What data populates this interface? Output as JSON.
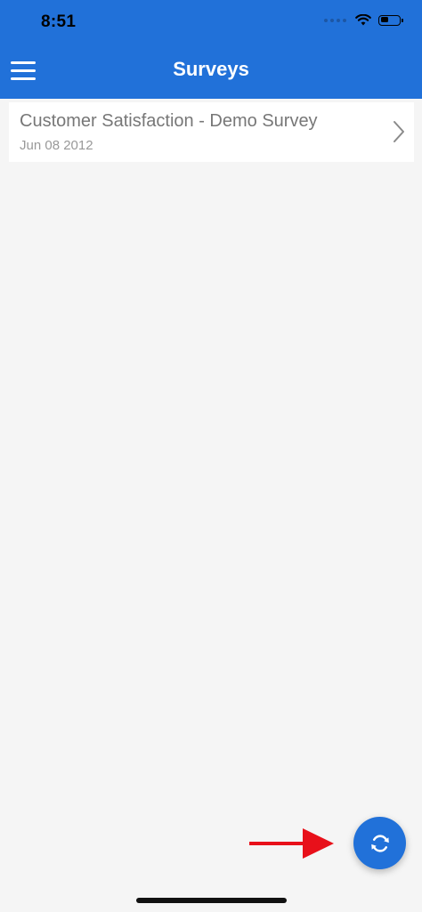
{
  "status_bar": {
    "time": "8:51",
    "icons": [
      "signal-dots-icon",
      "wifi-icon",
      "battery-icon"
    ],
    "battery_level": 0.4
  },
  "header": {
    "title": "Surveys",
    "menu_icon": "hamburger-menu-icon"
  },
  "surveys": [
    {
      "title": "Customer Satisfaction - Demo Survey",
      "date": "Jun 08 2012",
      "icon": "chevron-right-icon"
    }
  ],
  "fab": {
    "icon": "sync-icon"
  },
  "annotation": {
    "icon": "red-arrow-icon"
  },
  "colors": {
    "header_bg": "#2171d9",
    "page_bg": "#f5f5f5",
    "card_bg": "#ffffff",
    "fab_bg": "#2171d9",
    "arrow": "#e8101a"
  }
}
